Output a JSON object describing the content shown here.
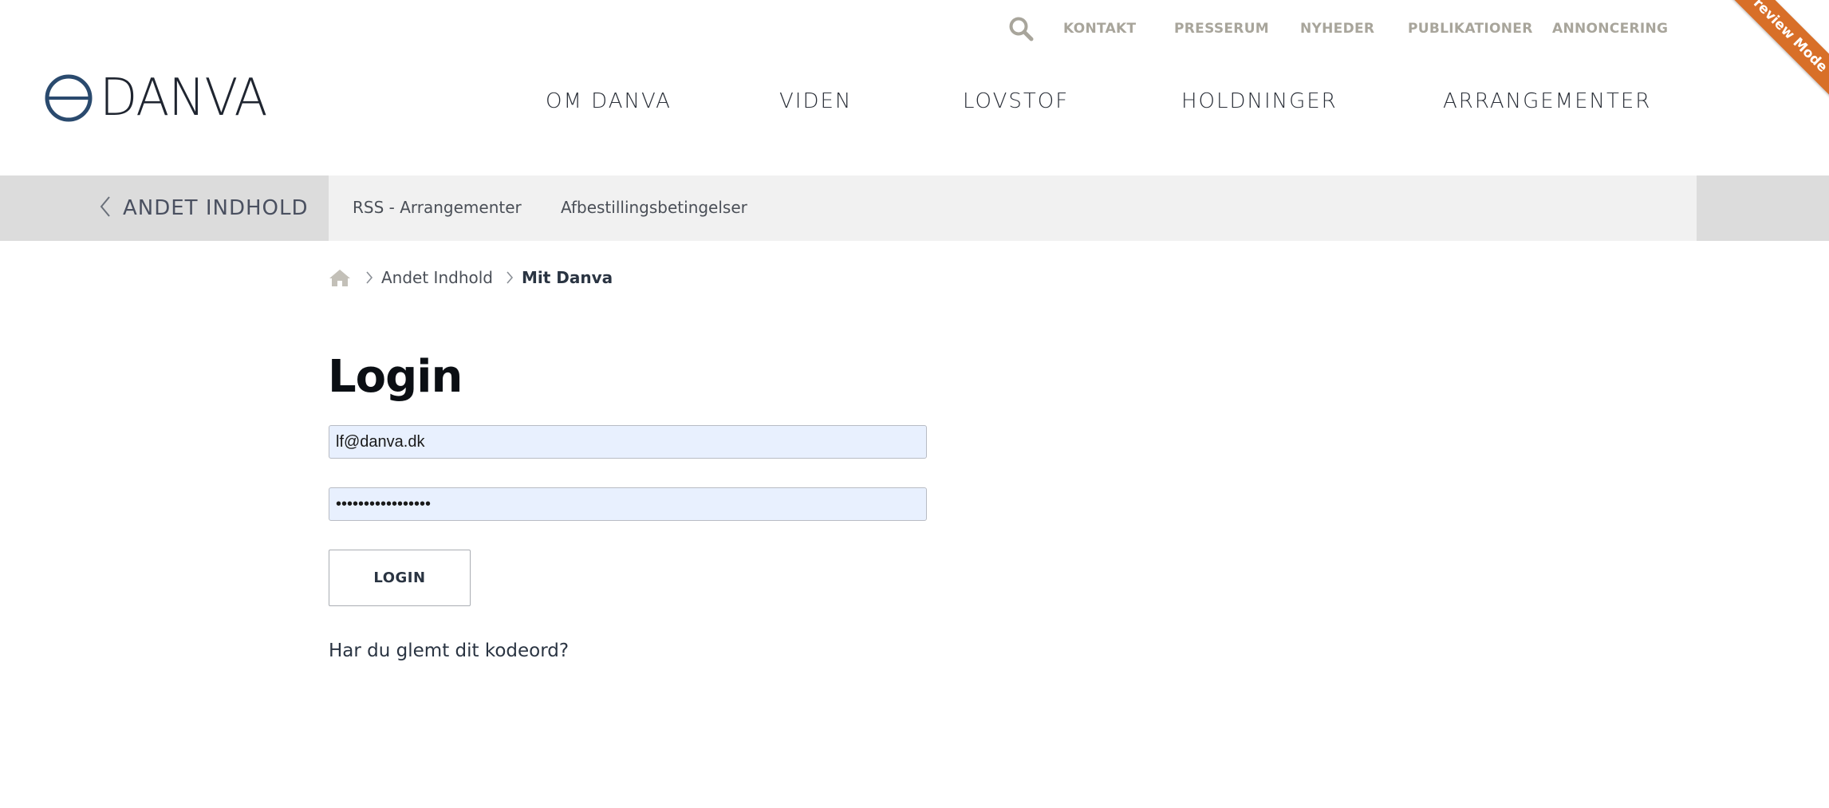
{
  "brand": {
    "name": "DANVA",
    "logo_color": "#2a4a6e",
    "accent_color": "#d86f28"
  },
  "utility_nav": {
    "search_icon": "search-icon",
    "links": [
      "KONTAKT",
      "PRESSERUM",
      "NYHEDER",
      "PUBLIKATIONER",
      "ANNONCERING"
    ]
  },
  "main_nav": {
    "items": [
      "OM DANVA",
      "VIDEN",
      "LOVSTOF",
      "HOLDNINGER",
      "ARRANGEMENTER"
    ]
  },
  "preview_ribbon": "Preview Mode",
  "subnav": {
    "back_label": "ANDET INDHOLD",
    "links": [
      "RSS - Arrangementer",
      "Afbestillingsbetingelser"
    ]
  },
  "breadcrumb": {
    "home_icon": "home-icon",
    "items": [
      "Andet Indhold"
    ],
    "current": "Mit Danva"
  },
  "login": {
    "title": "Login",
    "username_value": "lf@danva.dk",
    "password_value": "•••••••••••••••••",
    "button_label": "LOGIN",
    "forgot_link": "Har du glemt dit kodeord?"
  }
}
